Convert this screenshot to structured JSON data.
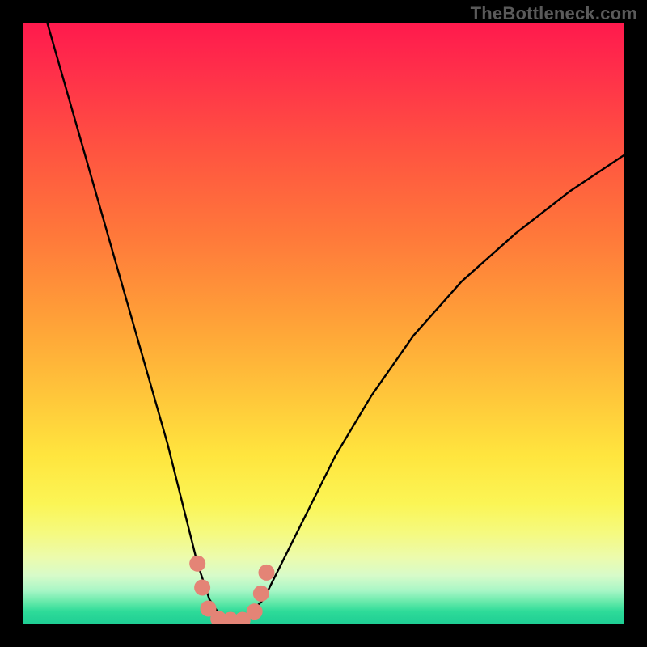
{
  "watermark": {
    "text": "TheBottleneck.com"
  },
  "chart_data": {
    "type": "line",
    "title": "",
    "xlabel": "",
    "ylabel": "",
    "xlim": [
      0,
      100
    ],
    "ylim": [
      0,
      100
    ],
    "grid": false,
    "legend": false,
    "background_gradient": {
      "top": "#ff1a4d",
      "mid": "#ffe53e",
      "bottom": "#1fce94"
    },
    "series": [
      {
        "name": "bottleneck-curve",
        "color": "#000000",
        "x": [
          4.0,
          8.0,
          12.0,
          16.0,
          20.0,
          24.0,
          27.0,
          29.0,
          31.0,
          33.0,
          35.0,
          37.0,
          40.0,
          43.0,
          47.0,
          52.0,
          58.0,
          65.0,
          73.0,
          82.0,
          91.0,
          100.0
        ],
        "values": [
          100.0,
          86.0,
          72.0,
          58.0,
          44.0,
          30.0,
          18.0,
          10.0,
          4.0,
          1.0,
          0.5,
          1.0,
          4.0,
          10.0,
          18.0,
          28.0,
          38.0,
          48.0,
          57.0,
          65.0,
          72.0,
          78.0
        ]
      }
    ],
    "markers": {
      "name": "bottleneck-minimum-dots",
      "color": "#e48476",
      "radius_px": 10,
      "points": [
        {
          "x": 29.0,
          "y": 10.0
        },
        {
          "x": 29.8,
          "y": 6.0
        },
        {
          "x": 30.8,
          "y": 2.5
        },
        {
          "x": 32.5,
          "y": 0.8
        },
        {
          "x": 34.5,
          "y": 0.6
        },
        {
          "x": 36.5,
          "y": 0.6
        },
        {
          "x": 38.5,
          "y": 2.0
        },
        {
          "x": 39.6,
          "y": 5.0
        },
        {
          "x": 40.5,
          "y": 8.5
        }
      ]
    }
  }
}
